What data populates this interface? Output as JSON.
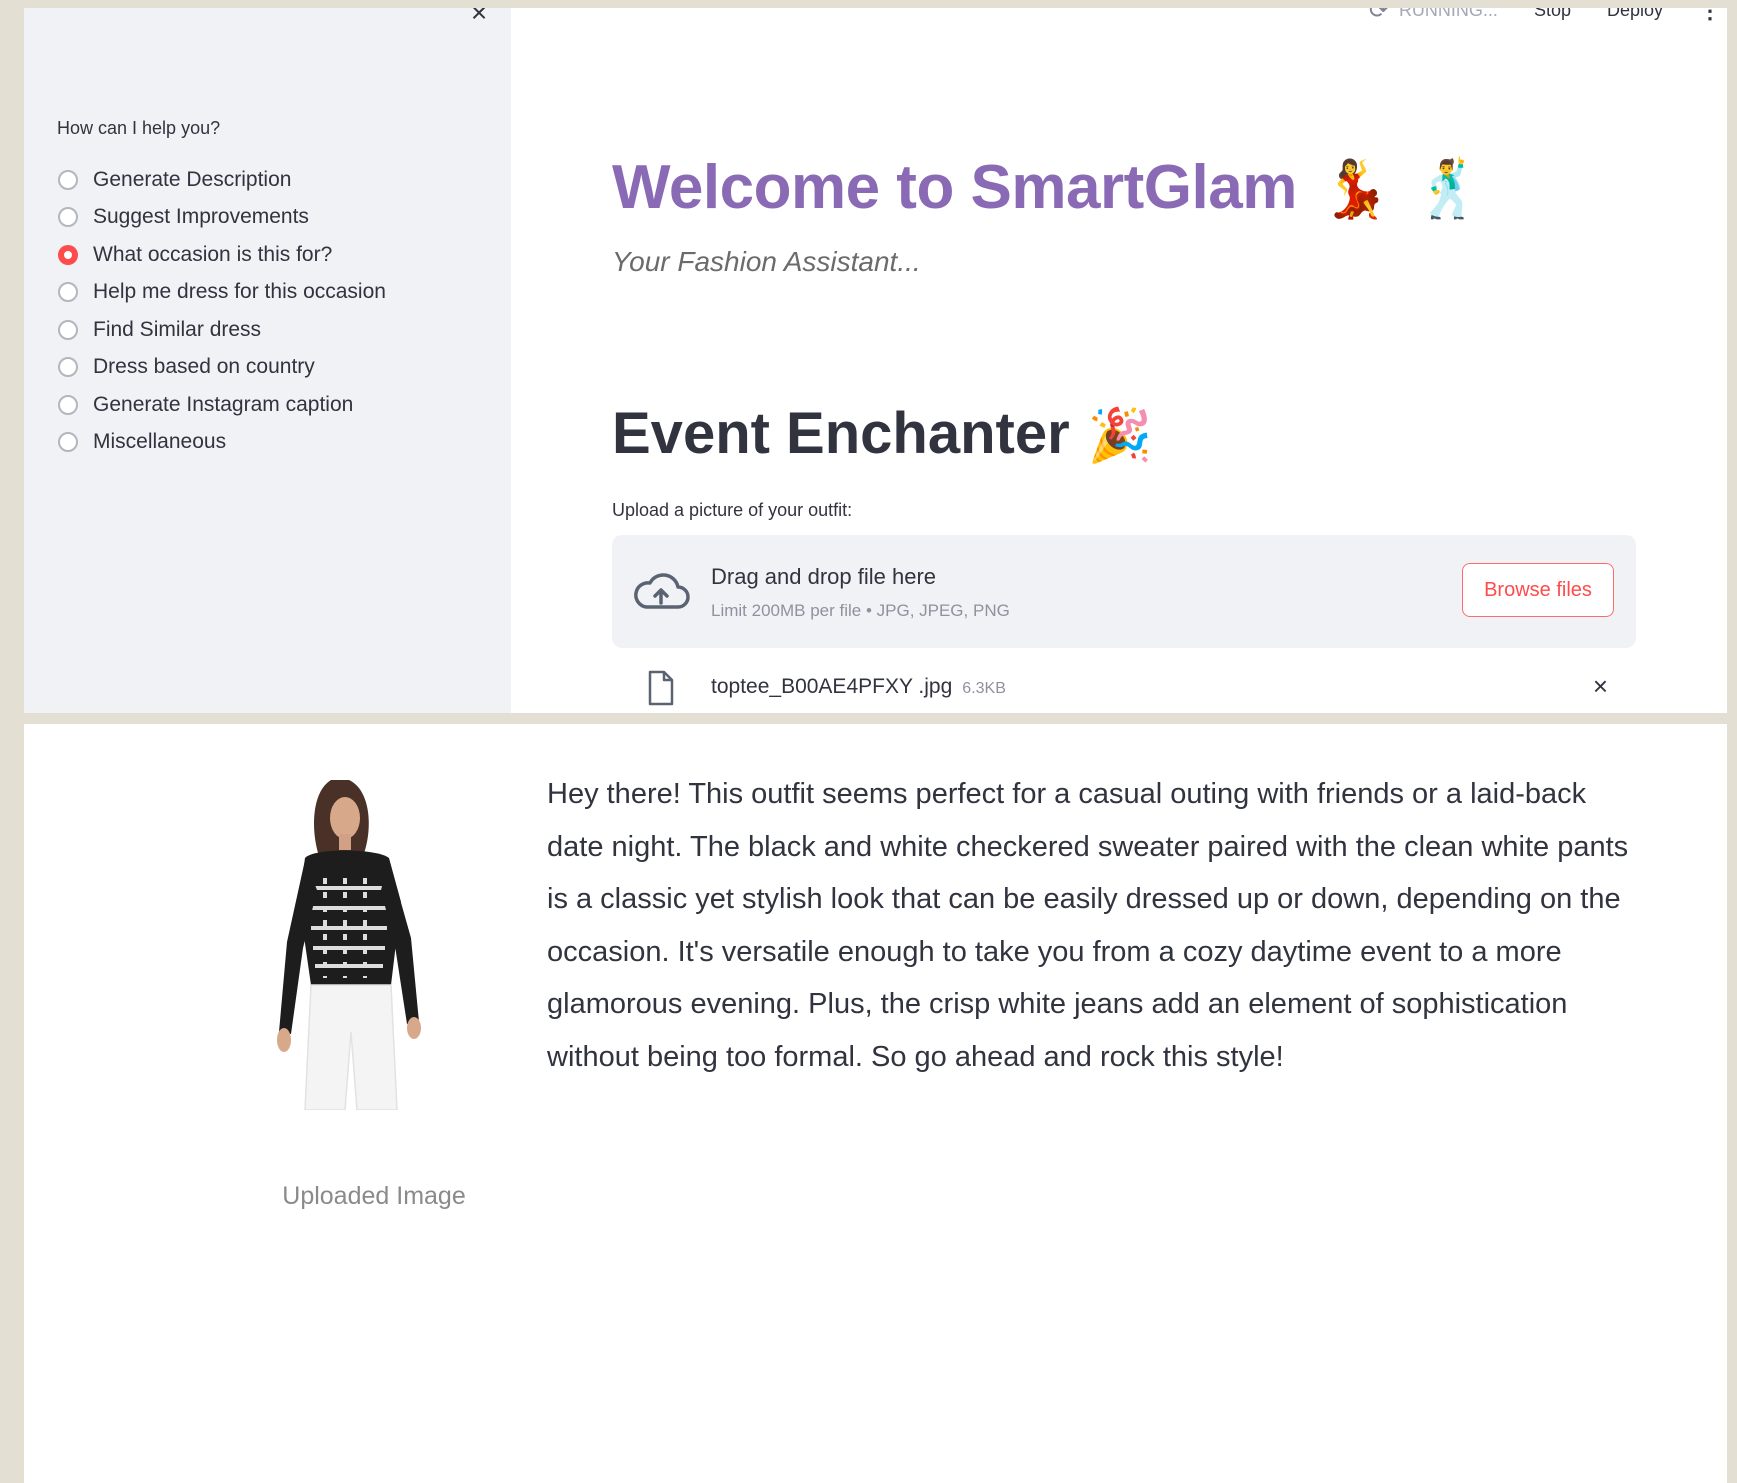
{
  "sidebar": {
    "close_glyph": "×",
    "radio_label": "How can I help you?",
    "options": [
      "Generate Description",
      "Suggest Improvements",
      "What occasion is this for?",
      "Help me dress for this occasion",
      "Find Similar dress",
      "Dress based on country",
      "Generate Instagram caption",
      "Miscellaneous"
    ],
    "selected_option": "What occasion is this for?"
  },
  "toolbar": {
    "status": "RUNNING...",
    "stop_label": "Stop",
    "deploy_label": "Deploy",
    "menu_glyph": "⋮"
  },
  "main": {
    "title": "Welcome to SmartGlam",
    "title_emoji_1": "💃",
    "title_emoji_2": "🕺",
    "subtitle": "Your Fashion Assistant...",
    "heading": "Event Enchanter",
    "heading_emoji": "🎉",
    "uploader": {
      "label": "Upload a picture of your outfit:",
      "drop_text": "Drag and drop file here",
      "limit_text": "Limit 200MB per file • JPG, JPEG, PNG",
      "browse_label": "Browse files",
      "file_name": "toptee_B00AE4PFXY .jpg",
      "file_size": "6.3KB",
      "remove_glyph": "×"
    }
  },
  "result": {
    "image_caption": "Uploaded Image",
    "response_text": "Hey there! This outfit seems perfect for a casual outing with friends or a laid-back date night. The black and white checkered sweater paired with the clean white pants is a classic yet stylish look that can be easily dressed up or down, depending on the occasion. It's versatile enough to take you from a cozy daytime event to a more glamorous evening. Plus, the crisp white jeans add an element of sophistication without being too formal. So go ahead and rock this style!"
  },
  "colors": {
    "accent": "#ff4b4b",
    "title": "#8a6ab5",
    "sidebar_bg": "#f0f2f6",
    "text": "#31333f"
  }
}
